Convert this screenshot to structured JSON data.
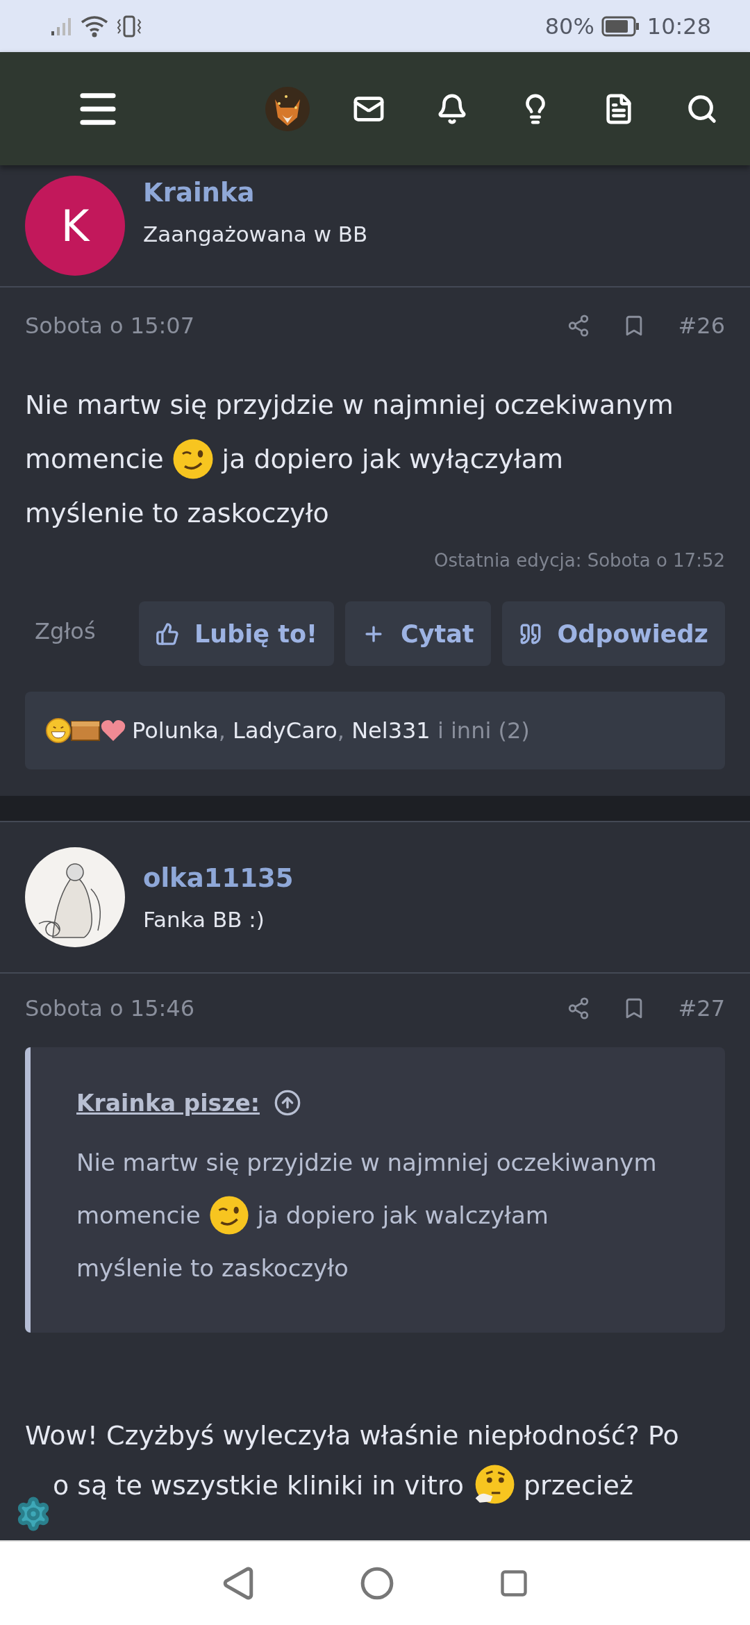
{
  "status_bar": {
    "battery_text": "80%",
    "time": "10:28"
  },
  "posts": [
    {
      "author": {
        "name": "Krainka",
        "title": "Zaangażowana w BB",
        "avatar": {
          "kind": "letter",
          "letter": "K",
          "color": "#c2185b"
        }
      },
      "date": "Sobota o 15:07",
      "number": "#26",
      "body": [
        [
          {
            "kind": "text",
            "text": "Nie martw się przyjdzie w najmniej oczekiwanym"
          }
        ],
        [
          {
            "kind": "text",
            "text": "momencie"
          },
          {
            "kind": "wink"
          },
          {
            "kind": "text",
            "text": "ja dopiero jak wyłączyłam"
          }
        ],
        [
          {
            "kind": "text",
            "text": "myślenie to zaskoczyło"
          }
        ]
      ],
      "edit_note": "Ostatnia edycja: Sobota o 17:52",
      "report": "Zgłoś",
      "actions": [
        {
          "kind": "like",
          "label": "Lubię to!"
        },
        {
          "kind": "plus",
          "label": "Cytat"
        },
        {
          "kind": "quote",
          "label": "Odpowiedz"
        }
      ],
      "reactions": {
        "emojis": [
          {
            "kind": "grin"
          },
          {
            "kind": "box"
          },
          {
            "kind": "heart"
          }
        ],
        "names": [
          "Polunka",
          "LadyCaro",
          "Nel331"
        ],
        "separators": [
          ",",
          ","
        ],
        "more": "i inni (2)"
      }
    },
    {
      "author": {
        "name": "olka11135",
        "title": "Fanka BB :)"
      },
      "date": "Sobota o 15:46",
      "number": "#27",
      "quote": {
        "source": "Krainka pisze:",
        "body": [
          [
            {
              "kind": "text",
              "text": "Nie martw się przyjdzie w najmniej oczekiwanym"
            }
          ],
          [
            {
              "kind": "text",
              "text": "momencie"
            },
            {
              "kind": "wink"
            },
            {
              "kind": "text",
              "text": "ja dopiero jak walczyłam"
            }
          ],
          [
            {
              "kind": "text",
              "text": "myślenie to zaskoczyło"
            }
          ]
        ]
      },
      "body": [
        [
          {
            "kind": "text",
            "text": "Wow! Czyżbyś wyleczyła właśnie niepłodność? Po"
          }
        ],
        [
          {
            "kind": "text",
            "text": "o są te wszystkie kliniki in vitro"
          },
          {
            "kind": "thinking"
          },
          {
            "kind": "text",
            "text": "przecież"
          }
        ]
      ]
    }
  ]
}
